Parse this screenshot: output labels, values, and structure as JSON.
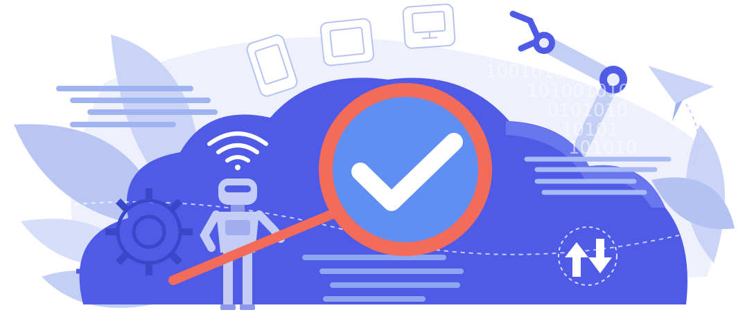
{
  "illustration": {
    "binary_rows": [
      "1001010",
      "101001010",
      "0101010",
      "10101",
      "101010"
    ],
    "colors": {
      "background": "#ffffff",
      "pale_shape": "#e8ecfb",
      "leaf": "#c9d4f7",
      "leaf_dark": "#9fb1ee",
      "cloud": "#4f5be6",
      "cloud_light": "#6a76ee",
      "lens_ring": "#f26b5b",
      "lens_glass": "#5f8ff2",
      "check": "#ffffff",
      "robot": "#c3cdf5",
      "robot_dark": "#8b99e8",
      "text_lines": "#8fa6f2"
    },
    "icons": [
      "cloud-icon",
      "magnifier-icon",
      "checkmark-icon",
      "robot-icon",
      "wifi-icon",
      "gear-icon",
      "transfer-arrows-icon",
      "smartphone-icon",
      "tablet-icon",
      "monitor-icon",
      "robotic-arm-icon",
      "paper-plane-icon"
    ]
  }
}
